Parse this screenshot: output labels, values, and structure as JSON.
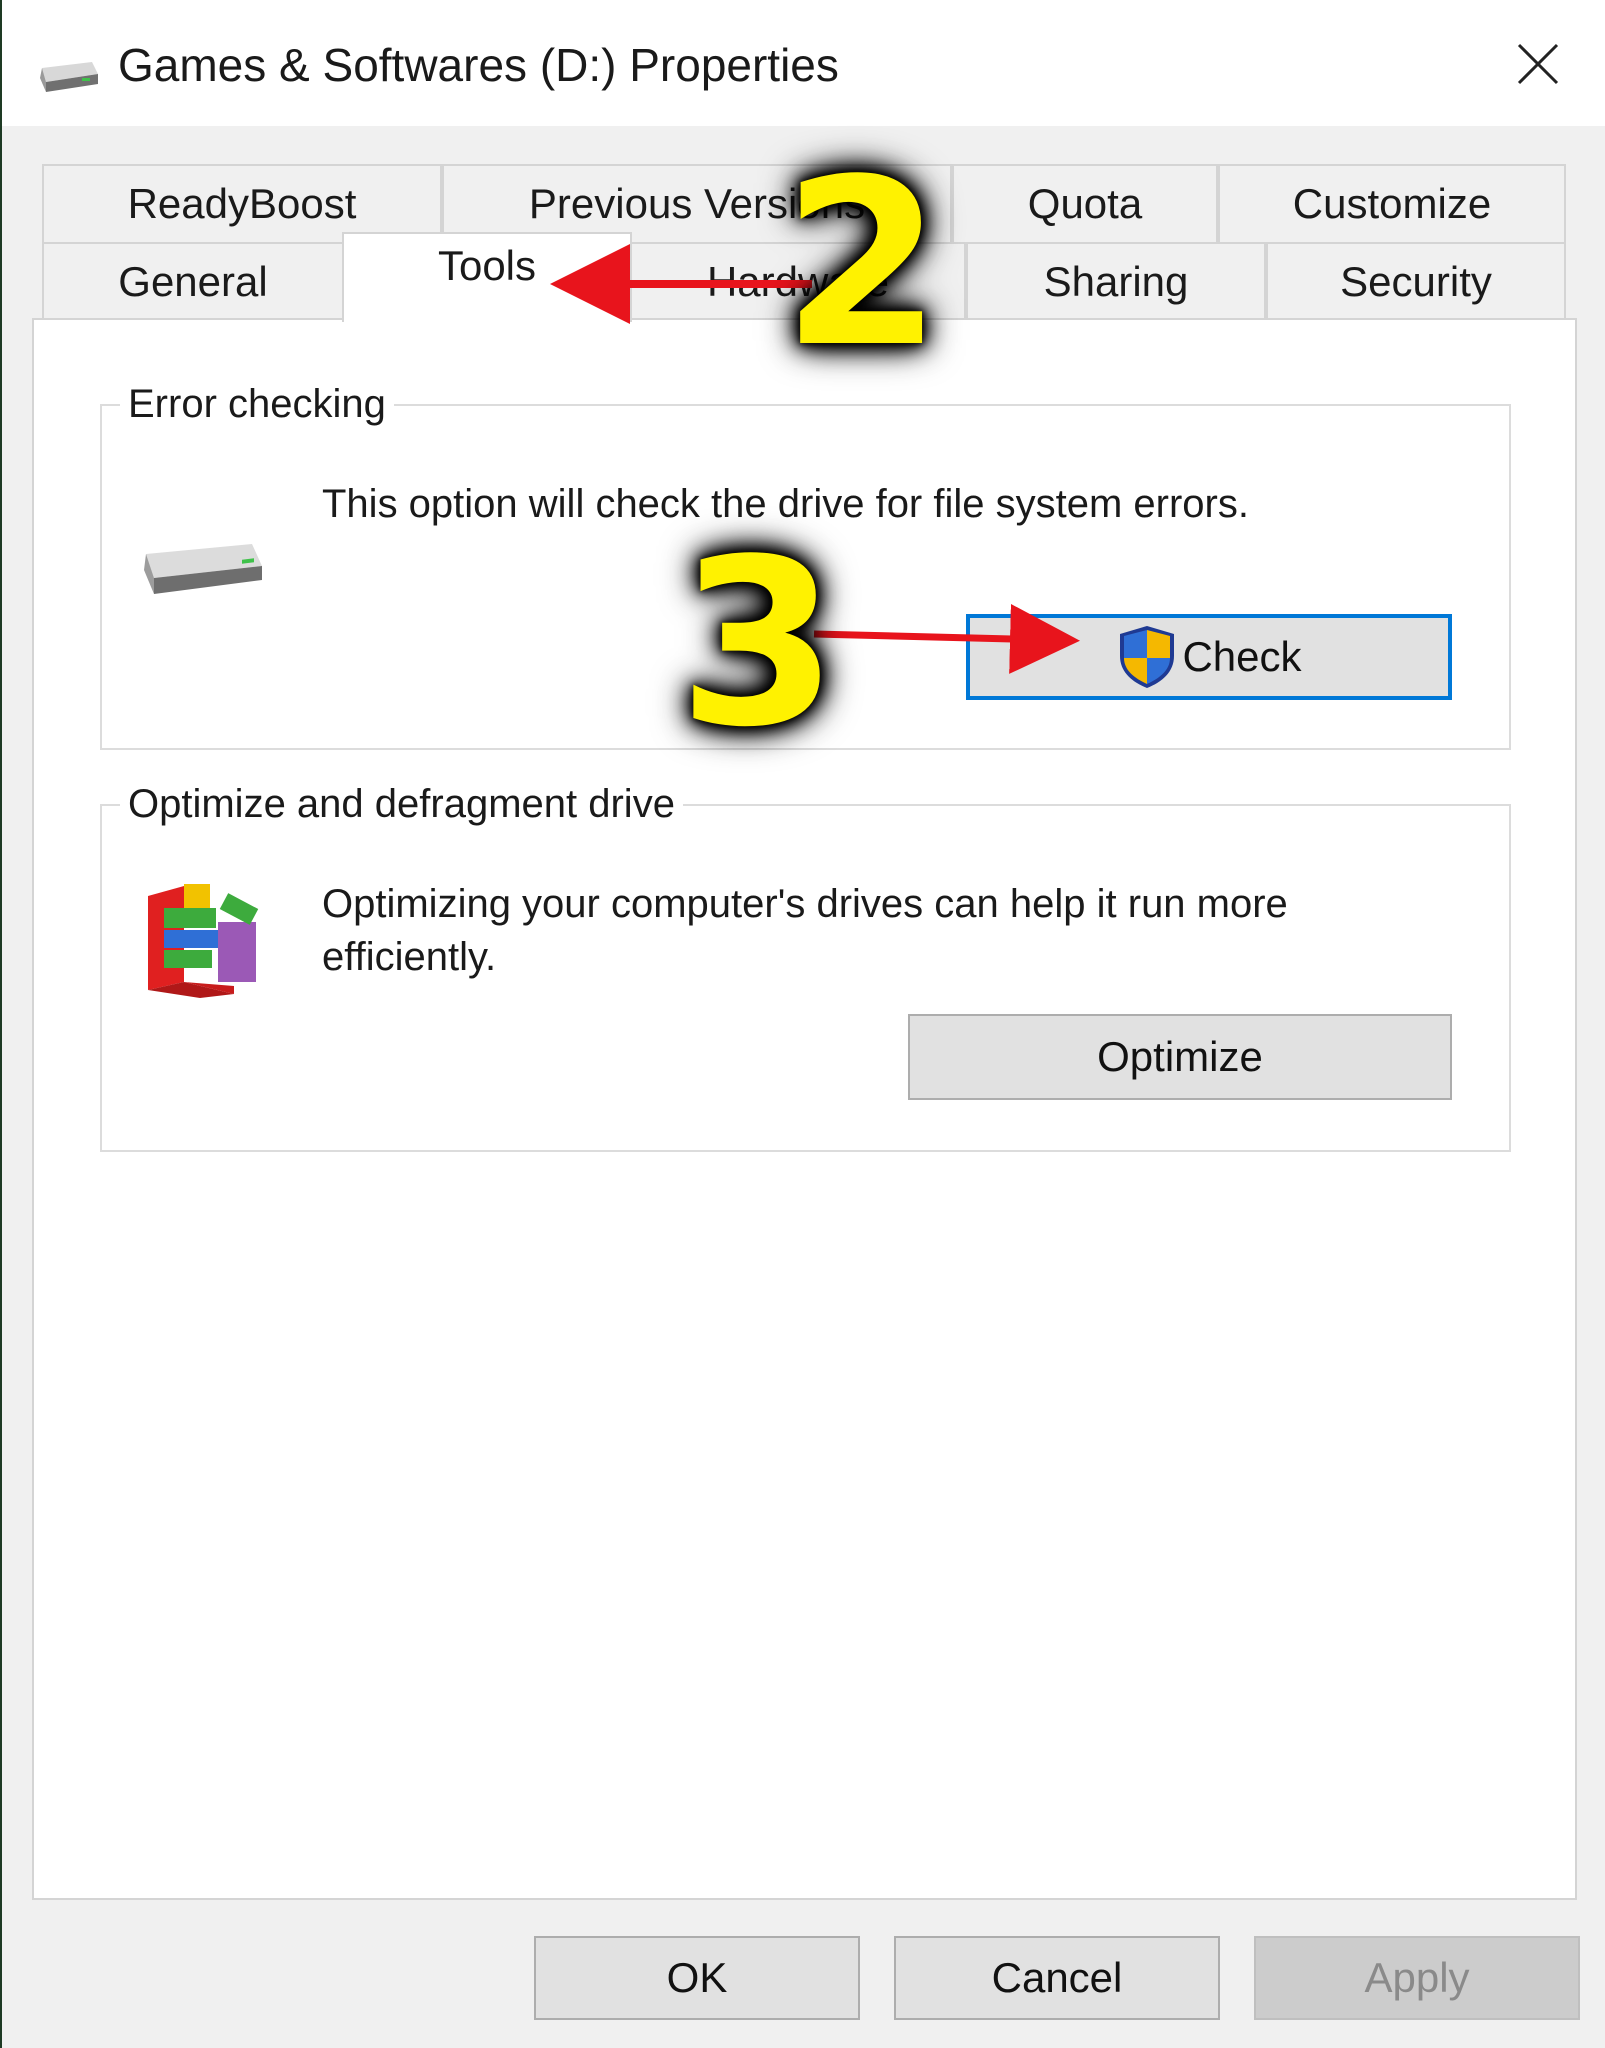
{
  "window": {
    "title": "Games & Softwares (D:) Properties",
    "icon": "drive-icon",
    "close_icon": "close-icon"
  },
  "tabs_top": [
    {
      "label": "ReadyBoost"
    },
    {
      "label": "Previous Versions"
    },
    {
      "label": "Quota"
    },
    {
      "label": "Customize"
    }
  ],
  "tabs_bottom": [
    {
      "label": "General"
    },
    {
      "label": "Tools",
      "active": true
    },
    {
      "label": "Hardware"
    },
    {
      "label": "Sharing"
    },
    {
      "label": "Security"
    }
  ],
  "error_checking": {
    "title": "Error checking",
    "description": "This option will check the drive for file system errors.",
    "button_label": "Check",
    "icon": "hard-drive-icon",
    "button_icon": "uac-shield-icon"
  },
  "optimize": {
    "title": "Optimize and defragment drive",
    "description": "Optimizing your computer's drives can help it run more efficiently.",
    "button_label": "Optimize",
    "icon": "defrag-icon"
  },
  "footer": {
    "ok_label": "OK",
    "cancel_label": "Cancel",
    "apply_label": "Apply"
  },
  "annotations": {
    "step2": "2",
    "step3": "3",
    "arrow_color": "#e8141c",
    "number_color": "#fff200"
  },
  "colors": {
    "focus_blue": "#0078d7",
    "dialog_bg": "#f0f0f0"
  }
}
